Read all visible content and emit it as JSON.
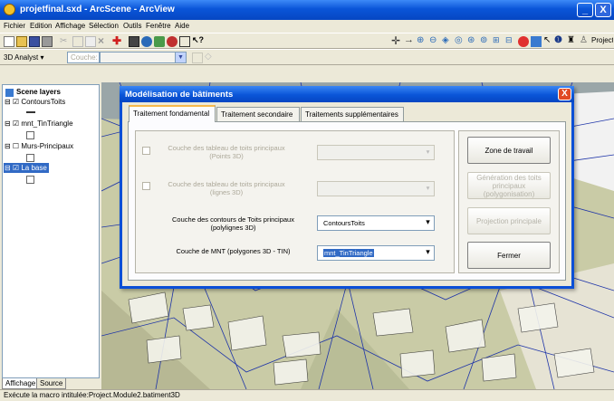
{
  "window": {
    "title": "projetfinal.sxd - ArcScene - ArcView",
    "minimize_label": "_",
    "close_label": "X"
  },
  "menu": [
    "Fichier",
    "Edition",
    "Affichage",
    "Sélection",
    "Outils",
    "Fenêtre",
    "Aide"
  ],
  "toolbar": {
    "macro_label": "Project.Module2.batiment3D"
  },
  "analyst": {
    "label": "3D Analyst ▾",
    "layer_placeholder": "Couche:"
  },
  "toc": {
    "root_label": "Scene layers",
    "layers": [
      "ContoursToits",
      "mnt_TinTriangle",
      "Murs-Principaux",
      "La base"
    ]
  },
  "bottom_tabs": [
    "Affichage",
    "Source"
  ],
  "status": "Exécute la macro intitulée:Project.Module2.batiment3D",
  "dialog": {
    "title": "Modélisation de bâtiments",
    "close_label": "X",
    "tabs": [
      "Traitement fondamental",
      "Traitement secondaire",
      "Traitements supplémentaires"
    ],
    "rows": [
      {
        "label1": "Couche des tableau de toits principaux",
        "label2": "(Points 3D)",
        "value": "",
        "enabled": false
      },
      {
        "label1": "Couche des tableau de toits principaux",
        "label2": "(lignes 3D)",
        "value": "",
        "enabled": false
      },
      {
        "label1": "Couche des contours de Toits principaux",
        "label2": "(polylignes 3D)",
        "value": "ContoursToits",
        "enabled": true
      },
      {
        "label1": "Couche de MNT  (polygones 3D - TIN)",
        "label2": "",
        "value": "mnt_TinTriangle",
        "enabled": true
      }
    ],
    "buttons": {
      "zone": "Zone de travail",
      "generation": "Génération des toits principaux (polygonisation)",
      "projection": "Projection principale",
      "close": "Fermer"
    }
  },
  "colors": {
    "xp_blue": "#0a55d8",
    "dialog_border": "#0a4fd6",
    "scene_bg": "#c9cba6",
    "selected_layer": "#316ac5"
  }
}
